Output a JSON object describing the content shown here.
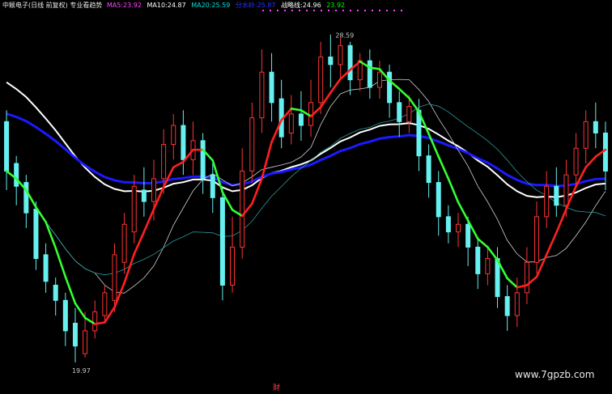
{
  "header": {
    "title": "中颖电子(日线 前复权) 专业看趋势",
    "items": [
      {
        "label": "MA5:",
        "value": "23.92",
        "color": "#ff44ff"
      },
      {
        "label": "MA10:",
        "value": "24.87",
        "color": "#ffffff"
      },
      {
        "label": "MA20:",
        "value": "25.59",
        "color": "#00e0e0"
      },
      {
        "label": "分水岭:",
        "value": "25.87",
        "color": "#3030ff"
      },
      {
        "label": "战略线:",
        "value": "24.96",
        "color": "#ffffff"
      },
      {
        "label": "",
        "value": "23.92",
        "color": "#00ff00"
      }
    ]
  },
  "colors": {
    "background": "#000000",
    "up_candle": "#ff3333",
    "down_candle": "#66f0f0",
    "white_line": "#ffffff",
    "blue_line": "#1a1aff",
    "trend_up": "#ff2020",
    "trend_down": "#33ff33"
  },
  "chart_data": {
    "type": "candlestick",
    "ylim": [
      19.5,
      29.2
    ],
    "annotations": [
      {
        "text": "28.59",
        "at": "high"
      },
      {
        "text": "19.97",
        "at": "low"
      }
    ],
    "marker": "财",
    "watermark": "www.7gpzb.com",
    "candles": [
      [
        26.3,
        25.0,
        26.6,
        24.5
      ],
      [
        25.2,
        24.6,
        25.4,
        24.1
      ],
      [
        24.7,
        23.9,
        24.9,
        23.5
      ],
      [
        24.0,
        22.7,
        24.2,
        22.4
      ],
      [
        22.8,
        22.1,
        23.1,
        21.8
      ],
      [
        22.0,
        21.6,
        22.2,
        21.2
      ],
      [
        21.6,
        20.8,
        21.8,
        20.4
      ],
      [
        21.0,
        20.4,
        21.4,
        19.97
      ],
      [
        20.2,
        20.8,
        21.3,
        20.1
      ],
      [
        20.8,
        21.3,
        21.6,
        20.6
      ],
      [
        21.2,
        21.8,
        22.0,
        21.0
      ],
      [
        21.6,
        22.8,
        23.1,
        21.3
      ],
      [
        22.6,
        23.6,
        23.9,
        22.3
      ],
      [
        23.4,
        24.6,
        24.9,
        23.1
      ],
      [
        24.5,
        24.2,
        25.1,
        23.8
      ],
      [
        24.2,
        24.8,
        25.3,
        23.7
      ],
      [
        24.8,
        25.7,
        26.1,
        24.4
      ],
      [
        25.7,
        26.2,
        26.5,
        25.3
      ],
      [
        26.2,
        25.3,
        26.6,
        24.9
      ],
      [
        25.3,
        25.8,
        26.3,
        24.9
      ],
      [
        25.8,
        24.8,
        26.0,
        24.4
      ],
      [
        24.9,
        24.3,
        25.2,
        23.9
      ],
      [
        24.3,
        22.0,
        24.6,
        21.6
      ],
      [
        22.0,
        23.0,
        23.8,
        21.8
      ],
      [
        23.0,
        25.0,
        25.6,
        22.7
      ],
      [
        25.0,
        26.4,
        26.8,
        24.7
      ],
      [
        26.4,
        27.6,
        28.2,
        26.0
      ],
      [
        27.6,
        26.8,
        28.1,
        26.3
      ],
      [
        26.9,
        25.9,
        27.4,
        25.6
      ],
      [
        26.0,
        26.5,
        27.0,
        25.7
      ],
      [
        26.5,
        26.2,
        27.1,
        25.8
      ],
      [
        26.2,
        26.8,
        27.4,
        25.9
      ],
      [
        26.8,
        28.0,
        28.4,
        26.5
      ],
      [
        28.0,
        27.8,
        28.59,
        27.2
      ],
      [
        27.8,
        28.3,
        28.5,
        27.4
      ],
      [
        28.3,
        27.4,
        28.4,
        27.0
      ],
      [
        27.4,
        27.9,
        28.1,
        27.1
      ],
      [
        27.9,
        27.2,
        28.2,
        26.9
      ],
      [
        27.2,
        27.6,
        27.9,
        26.9
      ],
      [
        27.6,
        26.8,
        27.8,
        26.4
      ],
      [
        26.8,
        26.3,
        27.1,
        25.9
      ],
      [
        26.3,
        26.7,
        27.0,
        26.0
      ],
      [
        26.6,
        25.4,
        26.9,
        25.0
      ],
      [
        25.4,
        24.7,
        25.7,
        24.3
      ],
      [
        24.7,
        23.8,
        25.0,
        23.3
      ],
      [
        23.8,
        23.4,
        24.1,
        23.1
      ],
      [
        23.4,
        23.6,
        23.9,
        23.0
      ],
      [
        23.6,
        23.0,
        23.8,
        22.5
      ],
      [
        23.0,
        22.3,
        23.2,
        21.9
      ],
      [
        22.3,
        22.7,
        23.0,
        22.0
      ],
      [
        22.7,
        21.7,
        23.0,
        21.4
      ],
      [
        21.7,
        21.2,
        22.0,
        20.8
      ],
      [
        21.2,
        21.8,
        22.2,
        20.9
      ],
      [
        21.8,
        22.6,
        23.0,
        21.5
      ],
      [
        22.6,
        23.8,
        24.2,
        22.3
      ],
      [
        23.8,
        24.6,
        25.0,
        23.5
      ],
      [
        24.6,
        24.1,
        25.1,
        23.8
      ],
      [
        24.1,
        24.9,
        25.3,
        23.8
      ],
      [
        24.9,
        25.6,
        26.0,
        24.6
      ],
      [
        25.6,
        26.3,
        26.6,
        25.2
      ],
      [
        26.3,
        26.0,
        26.8,
        25.6
      ],
      [
        26.0,
        25.0,
        26.3,
        24.5
      ]
    ]
  }
}
